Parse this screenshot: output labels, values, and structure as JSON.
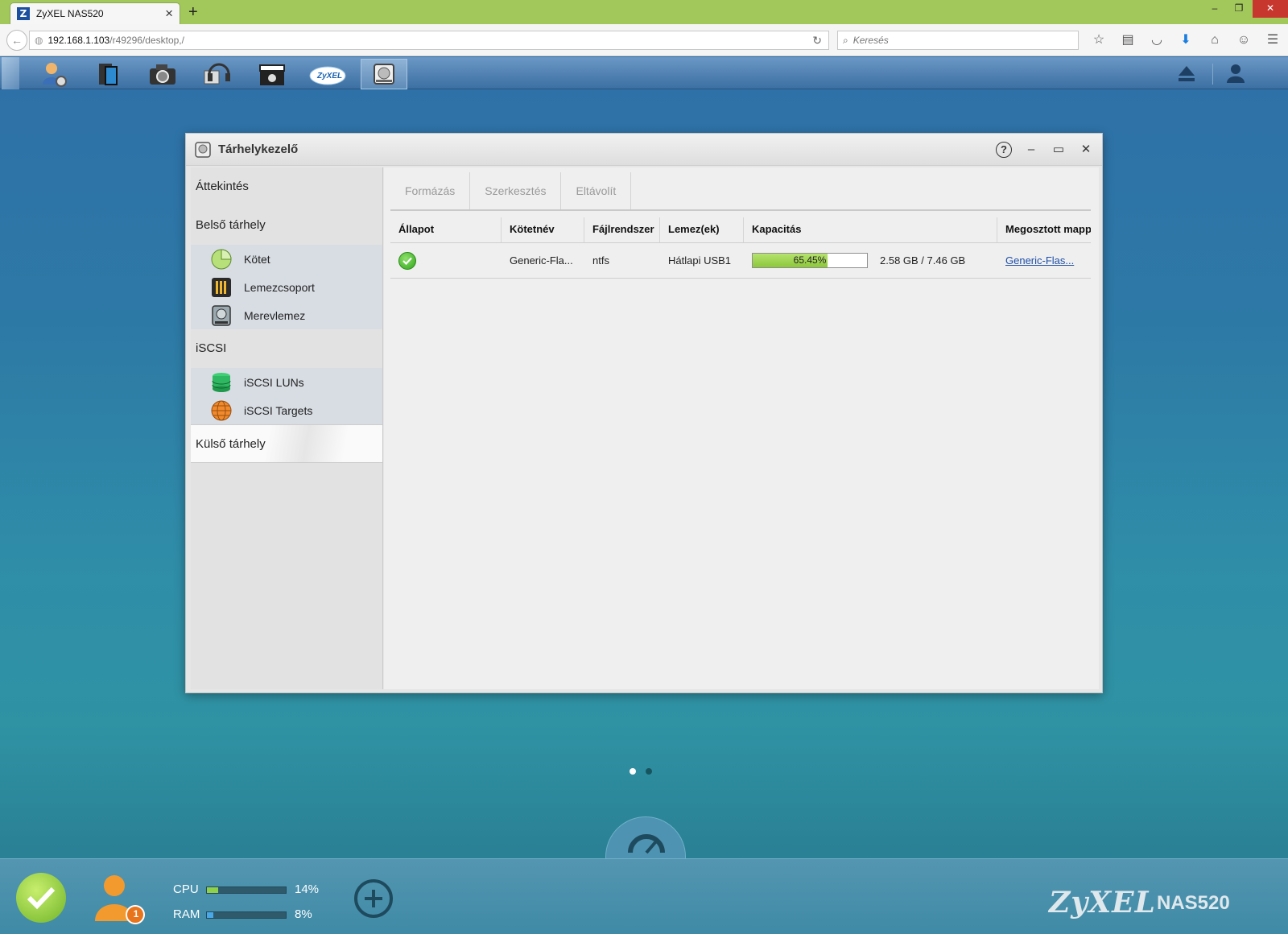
{
  "browser": {
    "tab_title": "ZyXEL NAS520",
    "favicon_letter": "Z",
    "url_host": "192.168.1.103",
    "url_path": "/r49296/desktop,/",
    "search_placeholder": "Keresés"
  },
  "window": {
    "title": "Tárhelykezelő",
    "help_label": "?"
  },
  "sidebar": {
    "overview": "Áttekintés",
    "internal": "Belső tárhely",
    "internal_items": [
      "Kötet",
      "Lemezcsoport",
      "Merevlemez"
    ],
    "iscsi": "iSCSI",
    "iscsi_items": [
      "iSCSI LUNs",
      "iSCSI Targets"
    ],
    "external": "Külső tárhely"
  },
  "toolbar": {
    "format": "Formázás",
    "edit": "Szerkesztés",
    "remove": "Eltávolít"
  },
  "table": {
    "headers": [
      "Állapot",
      "Kötetnév",
      "Fájlrendszer",
      "Lemez(ek)",
      "Kapacitás",
      "Megosztott mappa"
    ],
    "rows": [
      {
        "status": "ok",
        "name": "Generic-Fla...",
        "filesystem": "ntfs",
        "disks": "Hátlapi USB1",
        "usage_percent": 65.45,
        "usage_label": "65.45%",
        "capacity_text": "2.58 GB / 7.46 GB",
        "share": "Generic-Flas..."
      }
    ]
  },
  "bottom": {
    "cpu_label": "CPU",
    "cpu_value": "14%",
    "cpu_percent": 14,
    "ram_label": "RAM",
    "ram_value": "8%",
    "ram_percent": 8,
    "notification_count": "1",
    "brand": "ZyXEL",
    "model": "NAS520"
  },
  "colors": {
    "browser_tabbar": "#a2c85b",
    "progress_fill": "#9bd14a",
    "cpu_bar": "#8fd14a",
    "ram_bar": "#4aa8e8",
    "link": "#1f4fa8"
  }
}
